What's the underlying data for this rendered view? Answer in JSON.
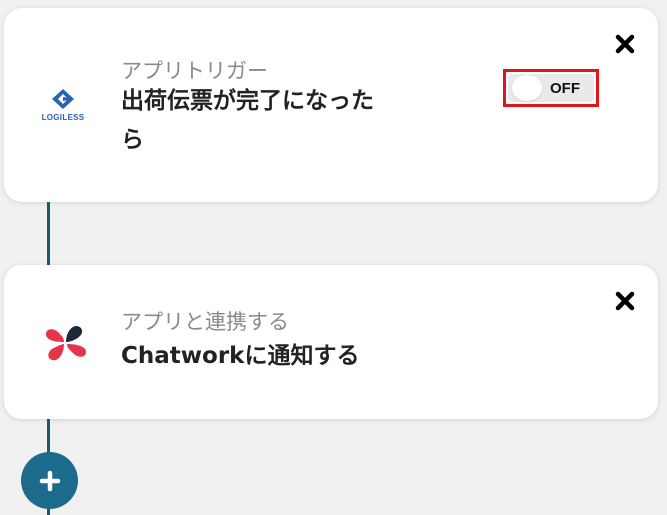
{
  "flow": {
    "trigger": {
      "category": "アプリトリガー",
      "title": "出荷伝票が完了になったら",
      "app_name": "LOGILESS",
      "app_icon": "logiless-logo-icon",
      "toggle_state": "OFF",
      "close_icon": "close-icon"
    },
    "action": {
      "category": "アプリと連携する",
      "title": "Chatworkに通知する",
      "app_icon": "chatwork-logo-icon",
      "close_icon": "close-icon"
    },
    "add_step_icon": "plus-icon"
  },
  "colors": {
    "background": "#f1f1f1",
    "connector": "#1c5a73",
    "add_button": "#1c6b8c",
    "highlight_border": "#e1141e",
    "logiless_blue": "#2a62b8",
    "chatwork_red": "#e8344a",
    "chatwork_dark": "#1b2a3a"
  }
}
